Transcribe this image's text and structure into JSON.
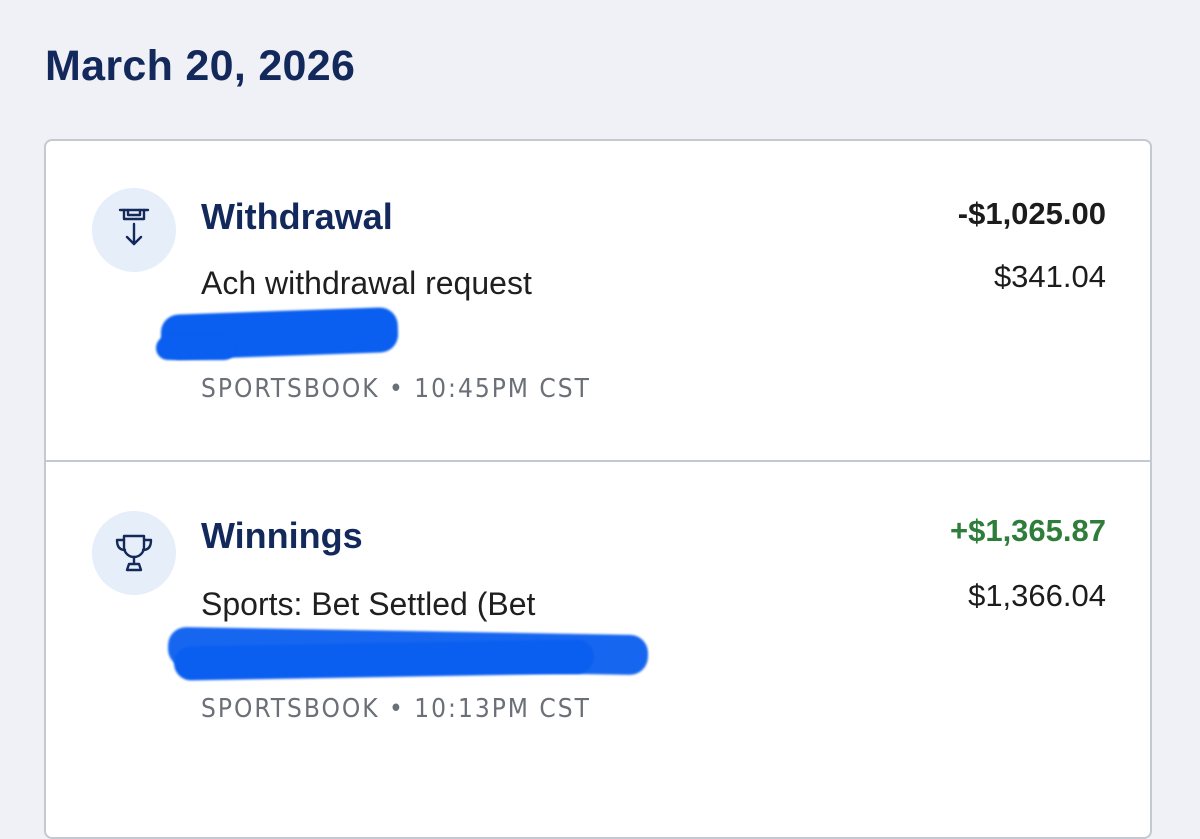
{
  "date_header": "March 20, 2026",
  "transactions": [
    {
      "title": "Withdrawal",
      "icon": "withdrawal-icon",
      "description": "Ach withdrawal request",
      "amount": "-$1,025.00",
      "balance": "$341.04",
      "source": "SPORTSBOOK",
      "separator": "•",
      "time": "10:45PM CST"
    },
    {
      "title": "Winnings",
      "icon": "trophy-icon",
      "description": "Sports: Bet Settled (Bet",
      "amount": "+$1,365.87",
      "balance": "$1,366.04",
      "source": "SPORTSBOOK",
      "separator": "•",
      "time": "10:13PM CST"
    }
  ],
  "colors": {
    "page_background": "#eff1f7",
    "header_navy": "#13295b",
    "positive_green": "#2e7d3a",
    "icon_background": "#e6eef9",
    "redaction_blue": "#0a5ef0"
  }
}
